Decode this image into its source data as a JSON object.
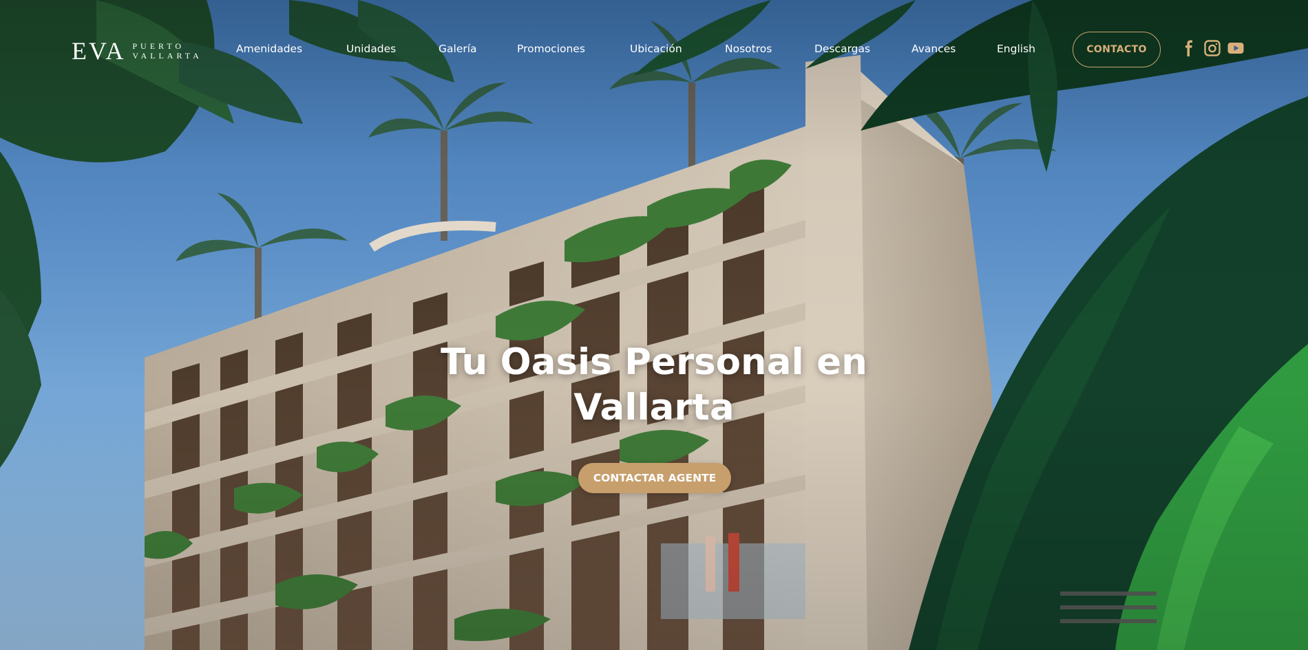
{
  "header": {
    "logo": {
      "main": "EVA",
      "sub_line1": "PUERTO",
      "sub_line2": "VALLARTA"
    },
    "nav": [
      {
        "label": "Amenidades"
      },
      {
        "label": "Unidades"
      },
      {
        "label": "Galería"
      },
      {
        "label": "Promociones"
      },
      {
        "label": "Ubicación"
      },
      {
        "label": "Nosotros"
      },
      {
        "label": "Descargas"
      },
      {
        "label": "Avances"
      },
      {
        "label": "English"
      }
    ],
    "contact_label": "CONTACTO",
    "social_icons": [
      "facebook-icon",
      "instagram-icon",
      "youtube-icon"
    ]
  },
  "hero": {
    "headline_line1": "Tu Oasis Personal en",
    "headline_line2": "Vallarta",
    "cta_label": "CONTACTAR AGENTE",
    "background_image": "tropical-building-render"
  },
  "colors": {
    "accent_gold": "#c79f6c",
    "contact_border": "#c9a36f",
    "text_white": "#ffffff",
    "sky": "#5b8fc8"
  }
}
